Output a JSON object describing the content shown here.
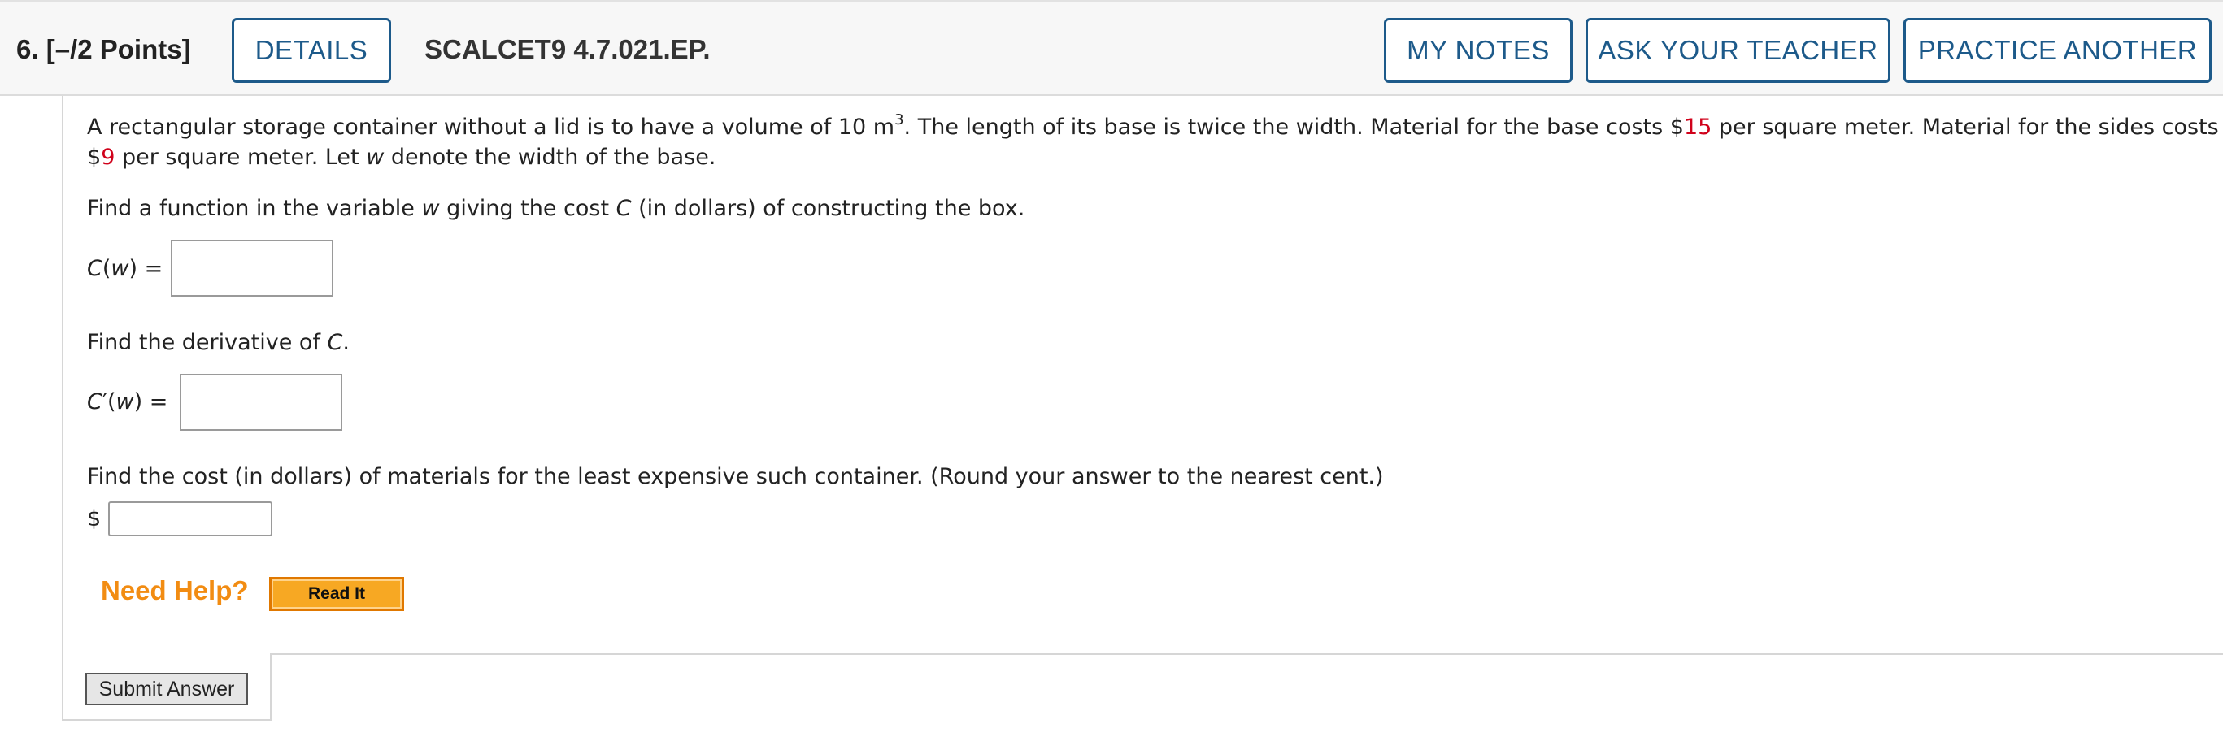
{
  "header": {
    "question_number": "6.",
    "points": "[–/2 Points]",
    "details_label": "DETAILS",
    "problem_code": "SCALCET9 4.7.021.EP.",
    "my_notes_label": "MY NOTES",
    "ask_teacher_label": "ASK YOUR TEACHER",
    "practice_another_label": "PRACTICE ANOTHER"
  },
  "problem": {
    "line1_a": "A rectangular storage container without a lid is to have a volume of 10 m",
    "line1_exp": "3",
    "line1_b": ". The length of its base is twice the width. Material for the base costs $",
    "base_cost": "15",
    "line1_c": " per square meter. Material for the sides costs",
    "line2_a": "$",
    "side_cost": "9",
    "line2_b": " per square meter. Let ",
    "var_w": "w",
    "line2_c": " denote the width of the base."
  },
  "part1": {
    "prompt_a": "Find a function in the variable ",
    "var_w": "w",
    "prompt_b": " giving the cost ",
    "var_c": "C",
    "prompt_c": " (in dollars) of constructing the box.",
    "label_c": "C",
    "label_paren_open": "(",
    "label_w": "w",
    "label_rest": ") =",
    "value": ""
  },
  "part2": {
    "prompt_a": "Find the derivative of ",
    "var_c": "C",
    "prompt_b": ".",
    "label_c": "C",
    "label_prime": "′(",
    "label_w": "w",
    "label_rest": ") =",
    "value": ""
  },
  "part3": {
    "prompt": "Find the cost (in dollars) of materials for the least expensive such container. (Round your answer to the nearest cent.)",
    "currency": "$",
    "value": ""
  },
  "help": {
    "need_help": "Need Help?",
    "read_it": "Read It"
  },
  "submit_label": "Submit Answer",
  "colors": {
    "accent": "#1d5a8a",
    "highlight_number": "#d0021b",
    "help": "#f28c12"
  }
}
